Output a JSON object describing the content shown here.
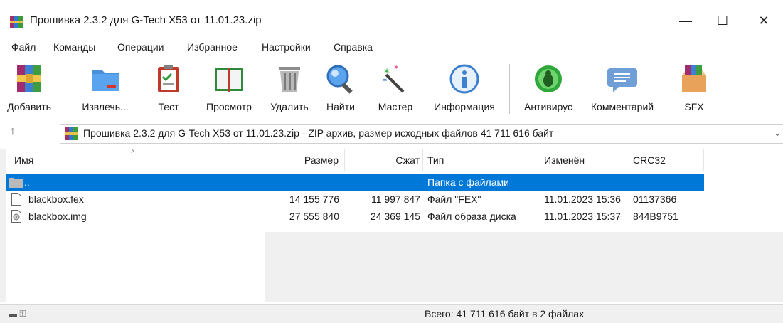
{
  "window": {
    "title": "Прошивка 2.3.2 для G-Tech X53 от 11.01.23.zip",
    "minimize": "—",
    "maximize": "☐",
    "close": "✕"
  },
  "menu": [
    {
      "label": "Файл"
    },
    {
      "label": "Команды"
    },
    {
      "label": "Операции"
    },
    {
      "label": "Избранное"
    },
    {
      "label": "Настройки"
    },
    {
      "label": "Справка"
    }
  ],
  "toolbar": [
    {
      "label": "Добавить",
      "icon": "add-archive-icon"
    },
    {
      "label": "Извлечь...",
      "icon": "extract-folder-icon"
    },
    {
      "label": "Тест",
      "icon": "test-clipboard-icon"
    },
    {
      "label": "Просмотр",
      "icon": "view-book-icon"
    },
    {
      "label": "Удалить",
      "icon": "delete-trash-icon"
    },
    {
      "label": "Найти",
      "icon": "find-magnifier-icon"
    },
    {
      "label": "Мастер",
      "icon": "wizard-wand-icon"
    },
    {
      "label": "Информация",
      "icon": "info-icon"
    },
    {
      "label": "Антивирус",
      "icon": "antivirus-bug-icon"
    },
    {
      "label": "Комментарий",
      "icon": "comment-icon"
    },
    {
      "label": "SFX",
      "icon": "sfx-box-icon"
    }
  ],
  "address": {
    "text": "Прошивка 2.3.2 для G-Tech X53 от 11.01.23.zip - ZIP архив, размер исходных файлов 41 711 616 байт"
  },
  "columns": {
    "name": "Имя",
    "size": "Размер",
    "packed": "Сжат",
    "type": "Тип",
    "modified": "Изменён",
    "crc": "CRC32"
  },
  "rows": [
    {
      "name": "..",
      "size": "",
      "packed": "",
      "type": "Папка с файлами",
      "modified": "",
      "crc": ""
    },
    {
      "name": "blackbox.fex",
      "size": "14 155 776",
      "packed": "11 997 847",
      "type": "Файл \"FEX\"",
      "modified": "11.01.2023 15:36",
      "crc": "01137366"
    },
    {
      "name": "blackbox.img",
      "size": "27 555 840",
      "packed": "24 369 145",
      "type": "Файл образа диска",
      "modified": "11.01.2023 15:37",
      "crc": "844B9751"
    }
  ],
  "status": {
    "text": "Всего: 41 711 616 байт в 2 файлах"
  },
  "colors": {
    "selection": "#0078d7",
    "accent": "#0078d7"
  }
}
